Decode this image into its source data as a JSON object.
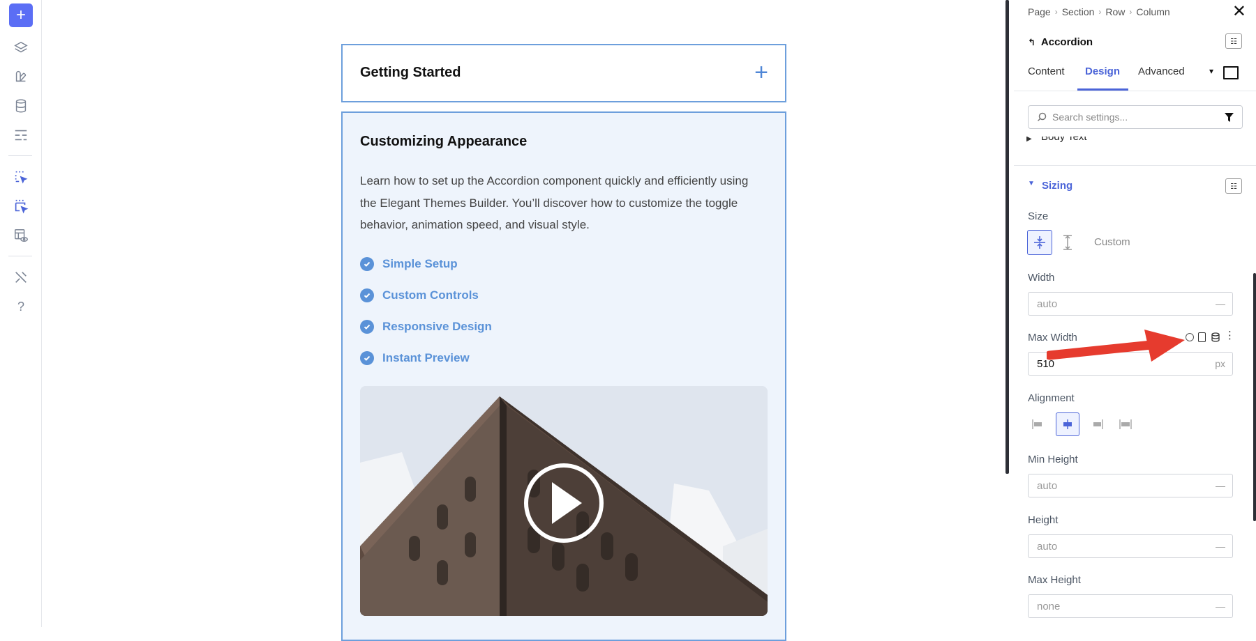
{
  "breadcrumb": [
    "Page",
    "Section",
    "Row",
    "Column"
  ],
  "panel": {
    "module_title": "Accordion",
    "tabs": [
      "Content",
      "Design",
      "Advanced"
    ],
    "active_tab": "Design",
    "search_placeholder": "Search settings...",
    "collapsed_section": "Body Text",
    "open_section": "Sizing",
    "size_label": "Size",
    "size_custom": "Custom",
    "width_label": "Width",
    "width_value": "auto",
    "max_width_label": "Max Width",
    "max_width_value": "510",
    "max_width_unit": "px",
    "alignment_label": "Alignment",
    "min_height_label": "Min Height",
    "min_height_value": "auto",
    "height_label": "Height",
    "height_value": "auto",
    "max_height_label": "Max Height",
    "max_height_value": "none",
    "field_dash": "—"
  },
  "accordion": {
    "closed_title": "Getting Started",
    "open_title": "Customizing Appearance",
    "body": "Learn how to set up the Accordion component quickly and efficiently using the Elegant Themes Builder. You’ll discover how to customize the toggle behavior, animation speed, and visual style.",
    "features": [
      "Simple Setup",
      "Custom Controls",
      "Responsive Design",
      "Instant Preview"
    ]
  },
  "left_bar": {
    "icons": [
      "add-icon",
      "layers-icon",
      "modules-icon",
      "database-icon",
      "layout-icon",
      "select-icon",
      "multi-select-icon",
      "preview-icon",
      "tools-icon",
      "help-icon"
    ],
    "help_text": "?"
  },
  "colors": {
    "accent": "#4b64d8",
    "accordion_border": "#6d9fdc",
    "feature_blue": "#5a92d8",
    "annotation_arrow": "#e63b2e"
  }
}
